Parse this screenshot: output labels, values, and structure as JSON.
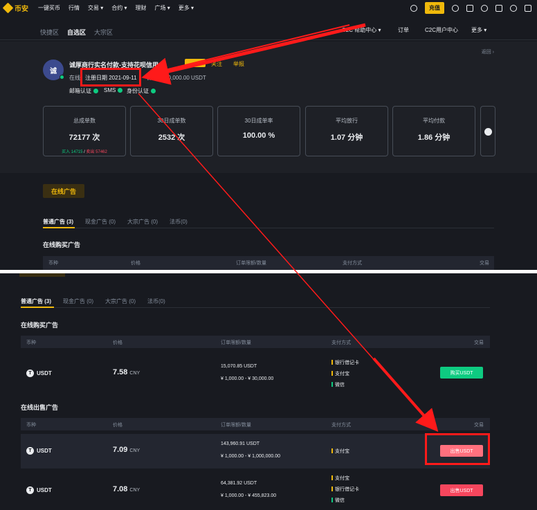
{
  "topnav": {
    "logo": "币安",
    "items": [
      "一键买币",
      "行情",
      "交易 ▾",
      "合约 ▾",
      "理财",
      "广场 ▾",
      "更多 ▾"
    ],
    "deposit_label": "充值"
  },
  "subnav": {
    "tabs": [
      "快捷区",
      "自选区",
      "大宗区"
    ],
    "right_links": [
      "C2C 帮助中心 ▾",
      "订单",
      "C2C用户中心",
      "更多 ▾"
    ]
  },
  "merchant": {
    "avatar_initial": "诚",
    "name": "诚厚商行实名付款-支持花呗信用卡",
    "follow_label": "关注",
    "report_label": "举报",
    "online_label": "在线",
    "register_date": "注册日期 2021-09-11",
    "deposit_amount": "保证金 30,000.00 USDT",
    "back_label": "返回 ›",
    "verifications": [
      "邮箱认证",
      "SMS",
      "身份认证"
    ]
  },
  "stats": [
    {
      "label": "总成单数",
      "value": "72177 次",
      "buy": "买入 14715",
      "sell": "卖出 57462"
    },
    {
      "label": "30日成单数",
      "value": "2532 次"
    },
    {
      "label": "30日成单率",
      "value": "100.00 %"
    },
    {
      "label": "平均放行",
      "value": "1.07 分钟"
    },
    {
      "label": "平均付款",
      "value": "1.86 分钟"
    }
  ],
  "online_ads_tab": "在线广告",
  "ad_tabs": [
    "普通广告 (3)",
    "现金广告 (0)",
    "大宗广告 (0)",
    "法币(0)"
  ],
  "buy_section_title": "在线购买广告",
  "sell_section_title": "在线出售广告",
  "table_headers": [
    "币种",
    "价格",
    "订单限额/数量",
    "支付方式",
    "交易"
  ],
  "buy_ads": [
    {
      "coin": "USDT",
      "price": "7.58",
      "currency": "CNY",
      "quantity": "15,070.85 USDT",
      "limit": "¥ 1,000.00 - ¥ 30,000.00",
      "payments": [
        "银行借记卡",
        "支付宝",
        "微信"
      ],
      "action": "购买USDT"
    }
  ],
  "sell_ads": [
    {
      "coin": "USDT",
      "price": "7.09",
      "currency": "CNY",
      "quantity": "143,960.91 USDT",
      "limit": "¥ 1,000.00 - ¥ 1,000,000.00",
      "payments": [
        "支付宝"
      ],
      "action": "出售USDT"
    },
    {
      "coin": "USDT",
      "price": "7.08",
      "currency": "CNY",
      "quantity": "64,381.92 USDT",
      "limit": "¥ 1,000.00 - ¥ 455,823.00",
      "payments": [
        "支付宝",
        "银行借记卡",
        "微信"
      ],
      "action": "出售USDT"
    }
  ],
  "colors": {
    "accent": "#f0b90b",
    "buy": "#0ecb81",
    "sell": "#f6465d",
    "annotation": "#ff1a1a"
  }
}
